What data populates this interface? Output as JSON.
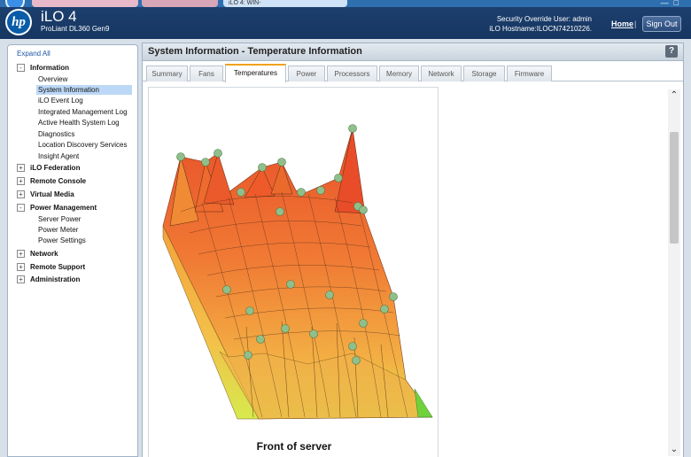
{
  "browser": {
    "tabs": [
      {
        "label": "",
        "active": false
      },
      {
        "label": "",
        "active": false
      },
      {
        "label": "iLO 4: WIN-",
        "active": true
      }
    ]
  },
  "header": {
    "product": "iLO 4",
    "server_model": "ProLiant DL360 Gen9",
    "user_line": "Security Override User:  admin",
    "hostname_line": "iLO Hostname:ILOCN74210226.",
    "home_label": "Home",
    "separator": "|",
    "signout_label": "Sign Out",
    "logo_text": "hp"
  },
  "sidebar": {
    "expand_all": "Expand All",
    "sections": [
      {
        "label": "Information",
        "expanded": true,
        "items": [
          "Overview",
          "System Information",
          "iLO Event Log",
          "Integrated Management Log",
          "Active Health System Log",
          "Diagnostics",
          "Location Discovery Services",
          "Insight Agent"
        ]
      },
      {
        "label": "iLO Federation",
        "expanded": false,
        "items": []
      },
      {
        "label": "Remote Console",
        "expanded": false,
        "items": []
      },
      {
        "label": "Virtual Media",
        "expanded": false,
        "items": []
      },
      {
        "label": "Power Management",
        "expanded": true,
        "items": [
          "Server Power",
          "Power Meter",
          "Power Settings"
        ]
      },
      {
        "label": "Network",
        "expanded": false,
        "items": []
      },
      {
        "label": "Remote Support",
        "expanded": false,
        "items": []
      },
      {
        "label": "Administration",
        "expanded": false,
        "items": []
      }
    ],
    "selected_item": "System Information"
  },
  "panel": {
    "title": "System Information - Temperature Information",
    "help": "?",
    "tabs": [
      "Summary",
      "Fans",
      "Temperatures",
      "Power",
      "Processors",
      "Memory",
      "Network",
      "Storage",
      "Firmware"
    ],
    "active_tab": "Temperatures"
  },
  "graph": {
    "caption": "Front of server",
    "colors": {
      "hot": "#e8502a",
      "warm": "#f0a83a",
      "cool": "#d8e84a",
      "cold": "#6fd23c",
      "sensor": "#8fbf8a"
    }
  },
  "scroll": {
    "up": "^",
    "down": "v"
  }
}
